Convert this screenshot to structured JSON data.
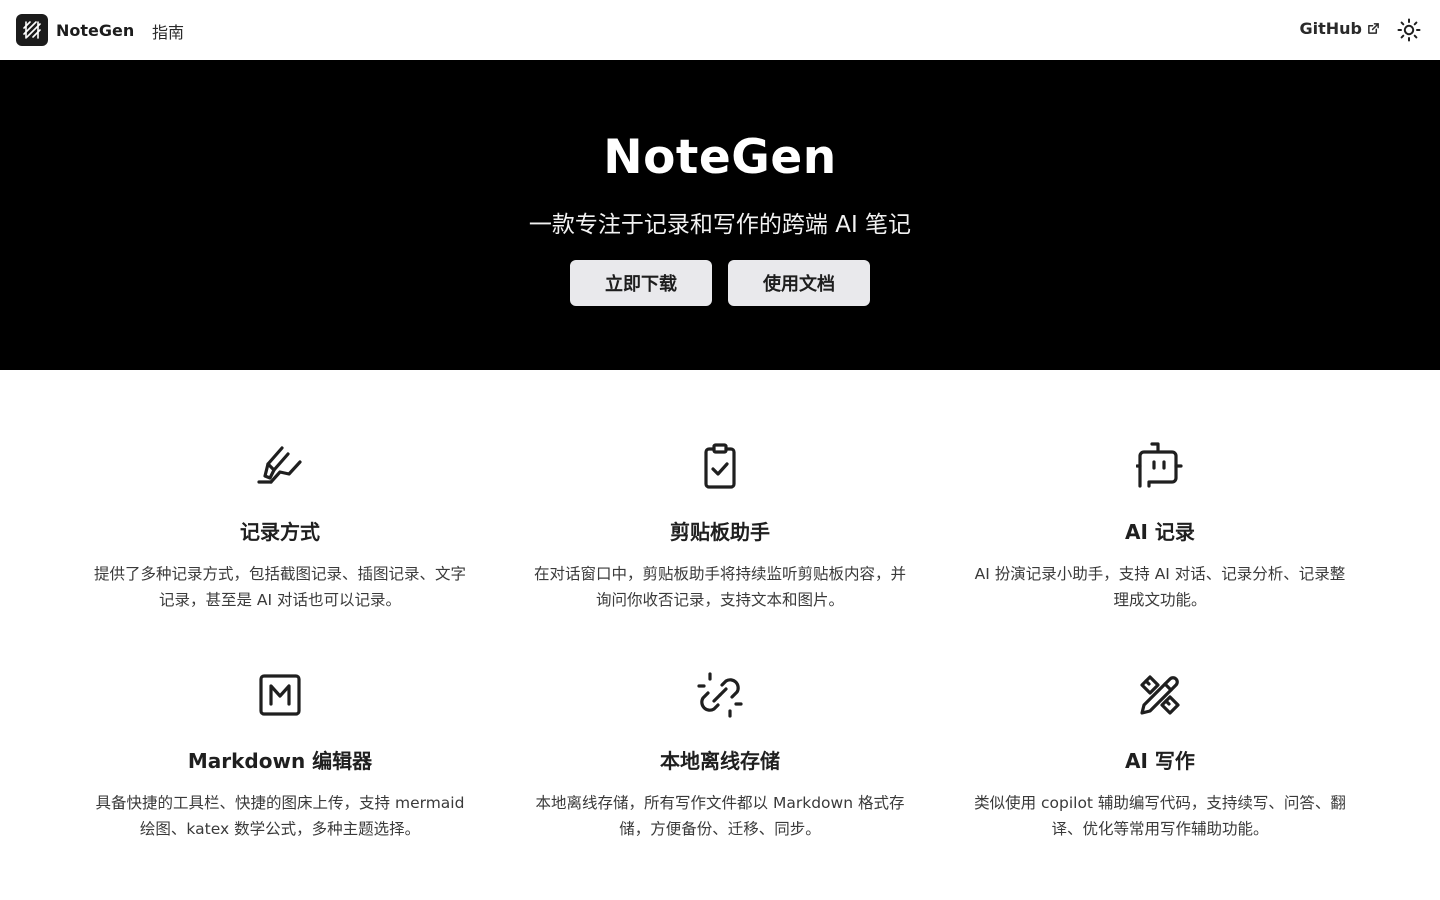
{
  "header": {
    "brand_name": "NoteGen",
    "nav_guide": "指南",
    "github_label": "GitHub",
    "icons": {
      "logo": "notegen-logo-icon",
      "external": "external-link-icon",
      "theme": "sun-icon"
    }
  },
  "hero": {
    "title": "NoteGen",
    "subtitle": "一款专注于记录和写作的跨端 AI 笔记",
    "download_label": "立即下载",
    "docs_label": "使用文档"
  },
  "features": [
    {
      "icon": "highlighter-icon",
      "title": "记录方式",
      "desc": "提供了多种记录方式，包括截图记录、插图记录、文字记录，甚至是 AI 对话也可以记录。"
    },
    {
      "icon": "clipboard-check-icon",
      "title": "剪贴板助手",
      "desc": "在对话窗口中，剪贴板助手将持续监听剪贴板内容，并询问你收否记录，支持文本和图片。"
    },
    {
      "icon": "bot-icon",
      "title": "AI 记录",
      "desc": "AI 扮演记录小助手，支持 AI 对话、记录分析、记录整理成文功能。"
    },
    {
      "icon": "markdown-icon",
      "title": "Markdown 编辑器",
      "desc": "具备快捷的工具栏、快捷的图床上传，支持 mermaid 绘图、katex 数学公式，多种主题选择。"
    },
    {
      "icon": "unlink-icon",
      "title": "本地离线存储",
      "desc": "本地离线存储，所有写作文件都以 Markdown 格式存储，方便备份、迁移、同步。"
    },
    {
      "icon": "pencil-ruler-icon",
      "title": "AI 写作",
      "desc": "类似使用 copilot 辅助编写代码，支持续写、问答、翻译、优化等常用写作辅助功能。"
    }
  ],
  "colors": {
    "hero_bg": "#000000",
    "button_bg": "#e9e9ec",
    "text": "#1f1f1f"
  }
}
